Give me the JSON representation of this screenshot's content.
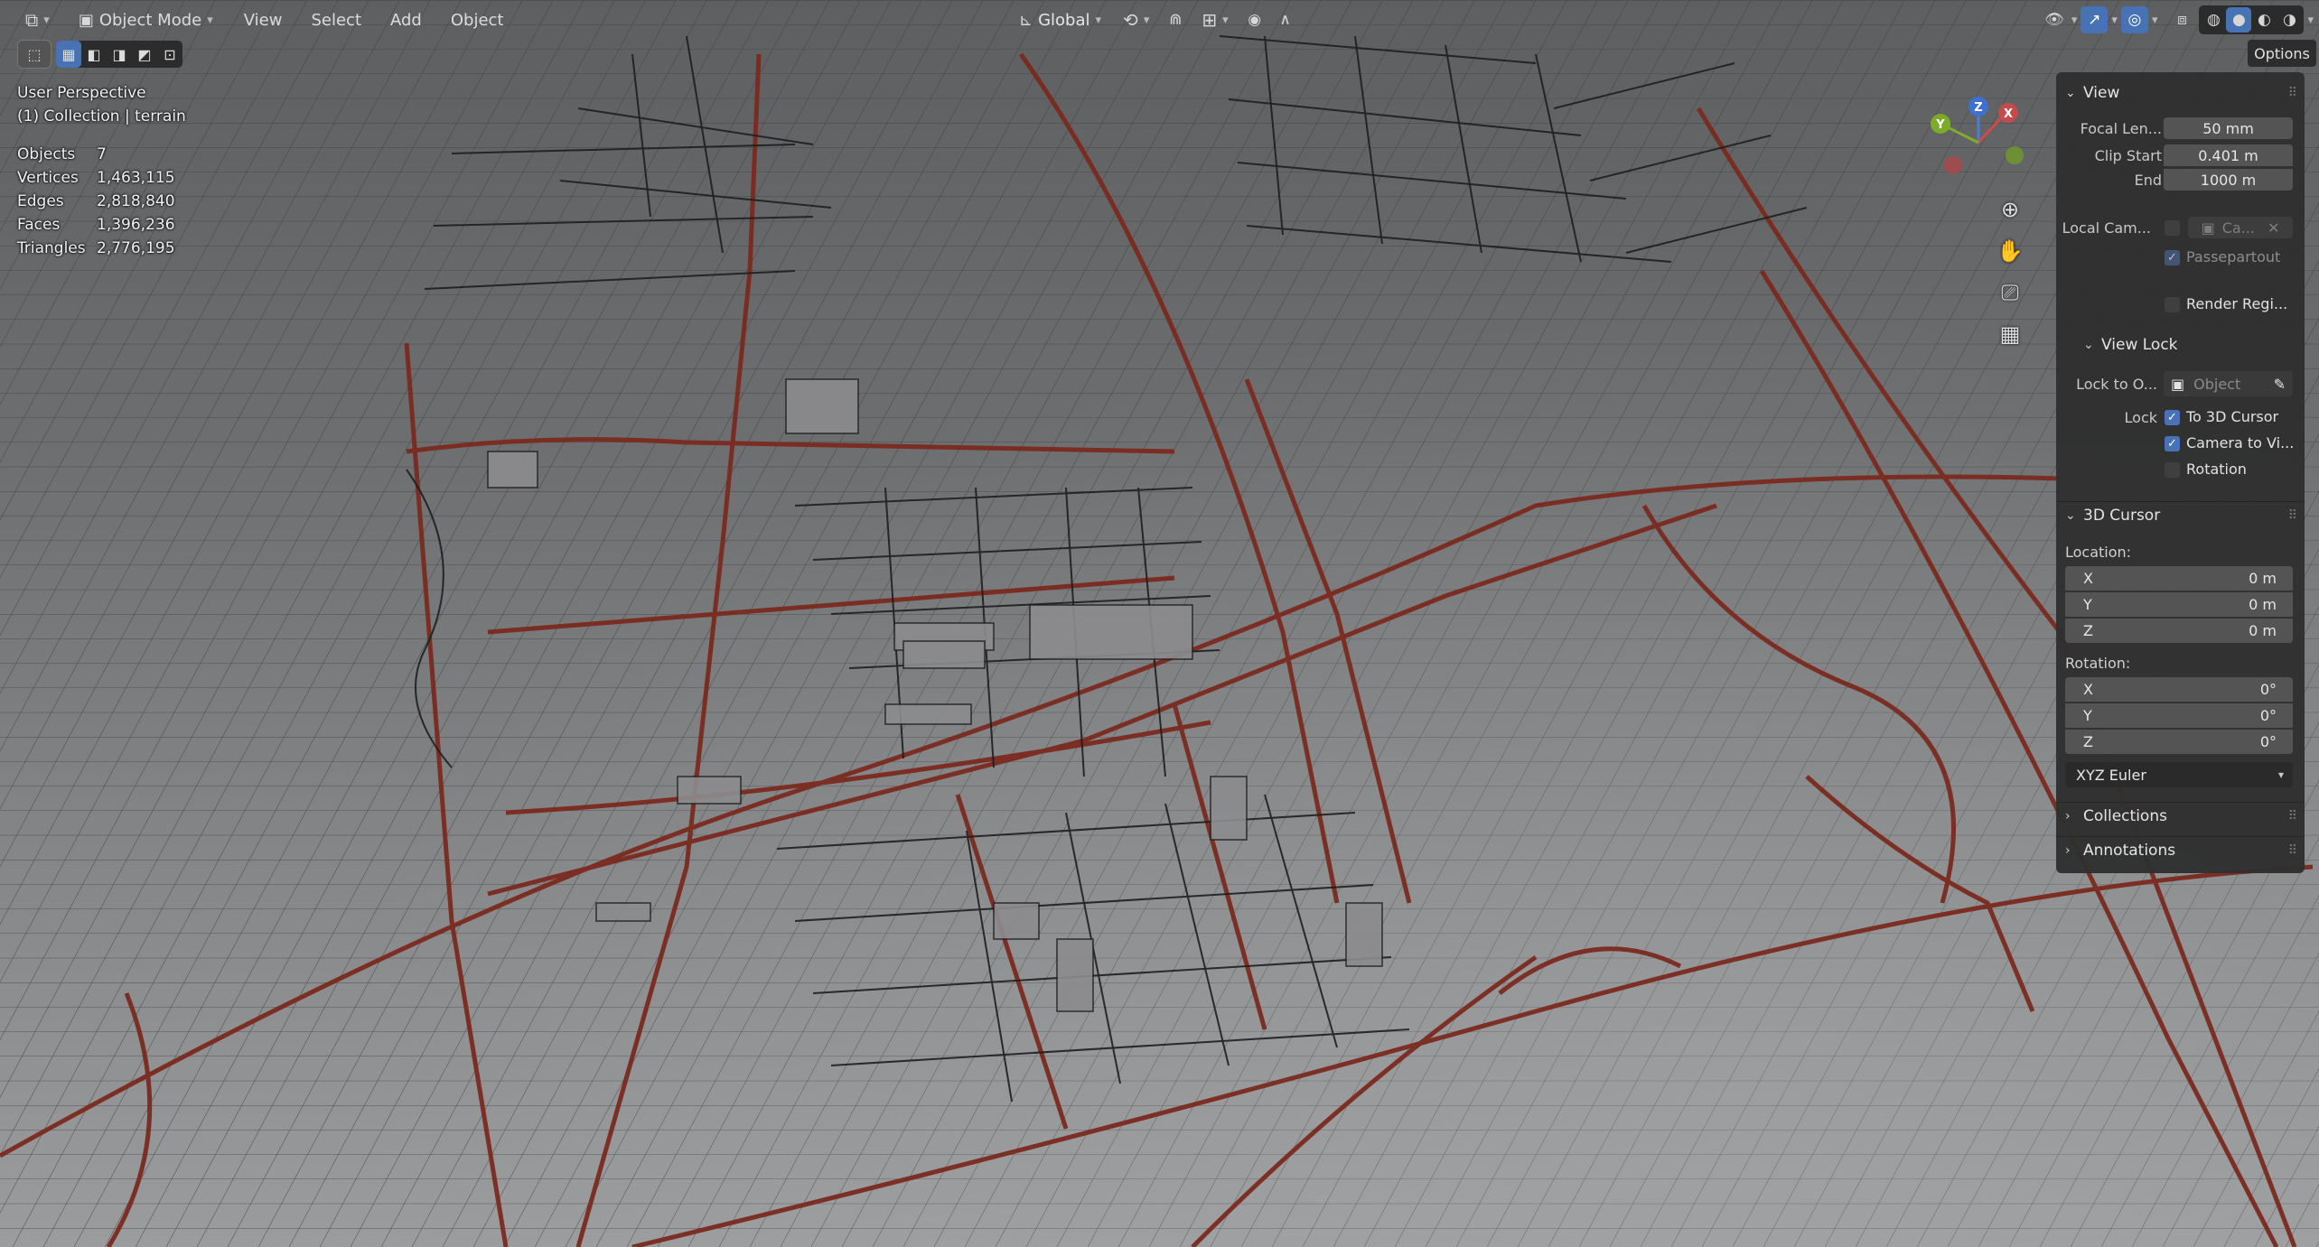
{
  "header": {
    "editor_icon": "editor-type-icon",
    "mode": "Object Mode",
    "menus": [
      "View",
      "Select",
      "Add",
      "Object"
    ],
    "transform_orientation": "Global"
  },
  "options_label": "Options",
  "overlay": {
    "perspective": "User Perspective",
    "collection": "(1) Collection | terrain",
    "stats": [
      {
        "label": "Objects",
        "value": "7"
      },
      {
        "label": "Vertices",
        "value": "1,463,115"
      },
      {
        "label": "Edges",
        "value": "2,818,840"
      },
      {
        "label": "Faces",
        "value": "1,396,236"
      },
      {
        "label": "Triangles",
        "value": "2,776,195"
      }
    ]
  },
  "gizmo": {
    "x": "X",
    "y": "Y",
    "z": "Z"
  },
  "npanel": {
    "view": {
      "title": "View",
      "focal_label": "Focal Len...",
      "focal_value": "50 mm",
      "clip_start_label": "Clip Start",
      "clip_start_value": "0.401 m",
      "clip_end_label": "End",
      "clip_end_value": "1000 m",
      "local_cam_label": "Local Cam...",
      "local_cam_value": "Ca...",
      "passepartout": "Passepartout",
      "render_region": "Render Regi..."
    },
    "view_lock": {
      "title": "View Lock",
      "lock_to_label": "Lock to O...",
      "lock_to_placeholder": "Object",
      "lock_label": "Lock",
      "to_cursor": "To 3D Cursor",
      "camera_to_view": "Camera to Vi...",
      "rotation": "Rotation"
    },
    "cursor": {
      "title": "3D Cursor",
      "location_label": "Location:",
      "location": [
        {
          "axis": "X",
          "value": "0 m"
        },
        {
          "axis": "Y",
          "value": "0 m"
        },
        {
          "axis": "Z",
          "value": "0 m"
        }
      ],
      "rotation_label": "Rotation:",
      "rotation": [
        {
          "axis": "X",
          "value": "0°"
        },
        {
          "axis": "Y",
          "value": "0°"
        },
        {
          "axis": "Z",
          "value": "0°"
        }
      ],
      "rotation_mode": "XYZ Euler"
    },
    "collections": "Collections",
    "annotations": "Annotations"
  },
  "colors": {
    "accent": "#4772b3",
    "road": "#7a2a1f",
    "grid": "#3a3b3d"
  }
}
